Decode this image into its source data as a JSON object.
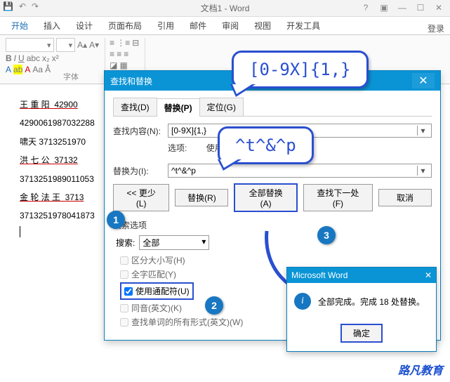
{
  "window": {
    "title": "文档1 - Word"
  },
  "ribbon": {
    "tabs": [
      "开始",
      "插入",
      "设计",
      "页面布局",
      "引用",
      "邮件",
      "审阅",
      "视图",
      "开发工具"
    ],
    "login": "登录",
    "font_group_label": "字体",
    "bold": "B",
    "italic": "I",
    "underline": "U"
  },
  "doc_lines": [
    "王 重 阳  42900",
    "4290061987032288",
    "啸天 3713251970",
    "洪 七 公  37132",
    "3713251989011053",
    "金 轮 法 王  3713",
    "3713251978041873"
  ],
  "dialog": {
    "title": "查找和替换",
    "tabs": {
      "find": "查找(D)",
      "replace": "替换(P)",
      "goto": "定位(G)"
    },
    "find_label": "查找内容(N):",
    "find_value": "[0-9X]{1,}",
    "options_label": "选项:",
    "options_value": "使用通配符",
    "replace_label": "替换为(I):",
    "replace_value": "^t^&^p",
    "less_btn": "<< 更少(L)",
    "replace_btn": "替换(R)",
    "replace_all_btn": "全部替换(A)",
    "find_next_btn": "查找下一处(F)",
    "cancel_btn": "取消",
    "search_options_h": "搜索选项",
    "search_label": "搜索:",
    "search_scope": "全部",
    "chk_case": "区分大小写(H)",
    "chk_whole": "全字匹配(Y)",
    "chk_wildcard": "使用通配符(U)",
    "chk_homophone": "同音(英文)(K)",
    "chk_allforms": "查找单词的所有形式(英文)(W)"
  },
  "callouts": {
    "c1": "[0-9X]{1,}",
    "c2": "^t^&^p"
  },
  "badges": {
    "b1": "1",
    "b2": "2",
    "b3": "3"
  },
  "msgbox": {
    "title": "Microsoft Word",
    "text": "全部完成。完成 18 处替换。",
    "ok": "确定"
  },
  "watermark": "路凡教育"
}
